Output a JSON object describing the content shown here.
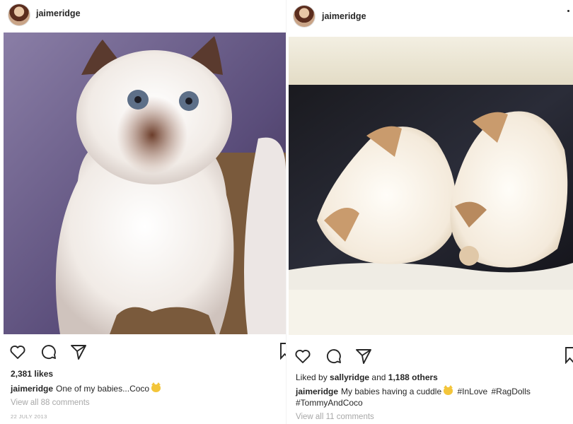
{
  "posts": [
    {
      "username": "jaimeridge",
      "photo_icon": "cat-photo",
      "icons": [
        "heart-icon",
        "comment-icon",
        "share-icon",
        "bookmark-icon"
      ],
      "likes": "2,381 likes",
      "caption_user": "jaimeridge",
      "caption_text": "One of my babies...Coco",
      "caption_emoji": "cat-face-emoji",
      "view_comments": "View all 88 comments",
      "timestamp": "22 JULY 2013"
    },
    {
      "username": "jaimeridge",
      "photo_icon": "cats-cuddling-photo",
      "icons": [
        "heart-icon",
        "comment-icon",
        "share-icon",
        "bookmark-icon"
      ],
      "liked_prefix": "Liked by",
      "liked_user": "sallyridge",
      "liked_and": "and",
      "liked_others": "1,188 others",
      "caption_user": "jaimeridge",
      "caption_text": "My babies having a cuddle",
      "caption_emoji": "cat-face-emoji",
      "caption_hashtags": "#InLove #RagDolls #TommyAndCoco",
      "view_comments": "View all 11 comments"
    }
  ],
  "colors": {
    "text": "#262626",
    "muted": "#a8a8a8"
  }
}
